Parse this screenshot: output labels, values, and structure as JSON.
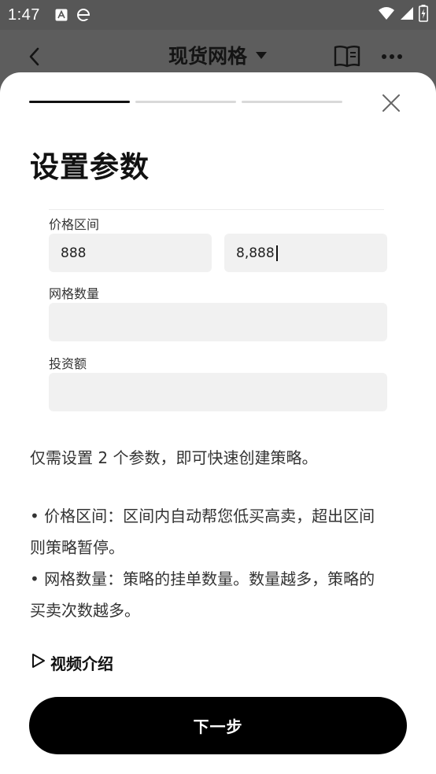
{
  "status_bar": {
    "time": "1:47",
    "icons": [
      "a-box-icon",
      "edge-browser-icon",
      "wifi-icon",
      "cellular-signal-icon",
      "battery-charging-icon"
    ]
  },
  "nav": {
    "title": "现货网格",
    "icons": [
      "back-chevron-icon",
      "dropdown-caret-icon",
      "book-icon",
      "more-dots-icon"
    ]
  },
  "sheet": {
    "progress": {
      "total_steps": 3,
      "current_step": 1
    },
    "title": "设置参数",
    "illustration": {
      "price_range_label": "价格区间",
      "price_low": "888",
      "price_high": "8,888",
      "grid_count_label": "网格数量",
      "investment_label": "投资额"
    },
    "intro": "仅需设置 2 个参数，即可快速创建策略。",
    "bullets": [
      {
        "line1": "• 价格区间：区间内自动帮您低买高卖，超出区间",
        "line2": "则策略暂停。"
      },
      {
        "line1": "• 网格数量：策略的挂单数量。数量越多，策略的",
        "line2": "买卖次数越多。"
      }
    ],
    "video_link": "视频介绍",
    "next_button": "下一步"
  },
  "colors": {
    "overlay": "#5d5d5d",
    "sheet_bg": "#ffffff",
    "primary_button": "#000000",
    "field_bg": "#f1f1f1"
  }
}
